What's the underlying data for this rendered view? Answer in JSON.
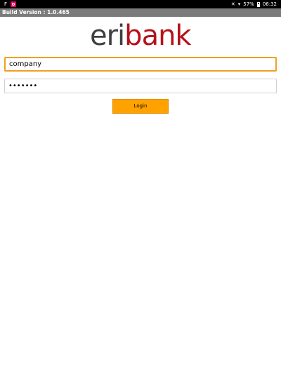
{
  "status_bar": {
    "notif_f": "F",
    "mute_icon": "✕",
    "wifi_icon": "▾",
    "battery": "57%",
    "time": "06:32"
  },
  "build_bar": {
    "text": "Build Version : 1.0.465"
  },
  "logo": {
    "part1": "eri",
    "part2": "bank"
  },
  "username": {
    "value": "company"
  },
  "password": {
    "value": "•••••••"
  },
  "login_button": {
    "label": "Login"
  },
  "colors": {
    "status_bar": "#000000",
    "build_bar": "#7b7b7b",
    "logo_dark": "#3f3f3f",
    "logo_red": "#b5121b",
    "focus_border": "#f0a020",
    "button": "#ffa200"
  }
}
